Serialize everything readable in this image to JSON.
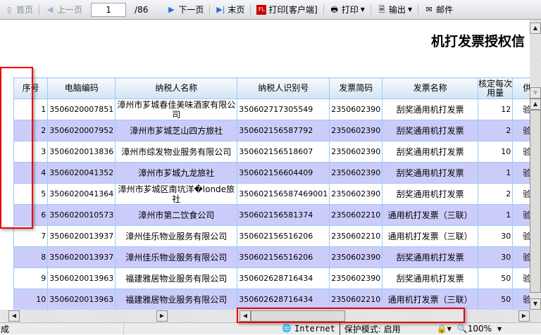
{
  "toolbar": {
    "first": "首页",
    "prev": "上一页",
    "page": "1",
    "total": "/86",
    "next": "下一页",
    "last": "末页",
    "print_client": "打印[客户端]",
    "print": "打印",
    "export": "输出",
    "mail": "邮件"
  },
  "report": {
    "title": "机打发票授权信"
  },
  "table": {
    "headers": [
      "序号",
      "电脑编码",
      "纳税人名称",
      "纳税人识别号",
      "发票简码",
      "发票名称",
      "核定每次用量",
      "供"
    ],
    "rows": [
      [
        "1",
        "3506020007851",
        "漳州市芗城春佳美味酒家有限公司",
        "350602717305549",
        "2350602390",
        "刮奖通用机打发票",
        "12",
        "验"
      ],
      [
        "2",
        "3506020007952",
        "漳州市芗城芝山四方旅社",
        "350602156587792",
        "2350602390",
        "刮奖通用机打发票",
        "2",
        "验"
      ],
      [
        "3",
        "3506020013836",
        "漳州市综发物业服务有限公司",
        "350602156518607",
        "2350602390",
        "刮奖通用机打发票",
        "10",
        "验"
      ],
      [
        "4",
        "3506020041352",
        "漳州市芗城九龙旅社",
        "350602156604409",
        "2350602390",
        "刮奖通用机打发票",
        "1",
        "验"
      ],
      [
        "5",
        "3506020041364",
        "漳州市芗城区南坑洋�londe旅社",
        "350602156587469001",
        "2350602390",
        "刮奖通用机打发票",
        "2",
        "验"
      ],
      [
        "6",
        "3506020010573",
        "漳州市第二饮食公司",
        "350602156581374",
        "2350602210",
        "通用机打发票（三联）",
        "1",
        "验"
      ],
      [
        "7",
        "3506020013937",
        "漳州佳乐物业服务有限公司",
        "350602156516206",
        "2350602210",
        "通用机打发票（三联）",
        "30",
        "验"
      ],
      [
        "8",
        "3506020013937",
        "漳州佳乐物业服务有限公司",
        "350602156516206",
        "2350602390",
        "刮奖通用机打发票",
        "30",
        "验"
      ],
      [
        "9",
        "3506020013963",
        "福建雅居物业服务有限公司",
        "350602628716434",
        "2350602390",
        "刮奖通用机打发票",
        "50",
        "验"
      ],
      [
        "10",
        "3506020013963",
        "福建雅居物业服务有限公司",
        "350602628716434",
        "2350602210",
        "通用机打发票（三联）",
        "50",
        "验"
      ]
    ]
  },
  "status": {
    "left": "成",
    "zone": "Internet",
    "protected": "保护模式: 启用",
    "zoom": "100%"
  }
}
